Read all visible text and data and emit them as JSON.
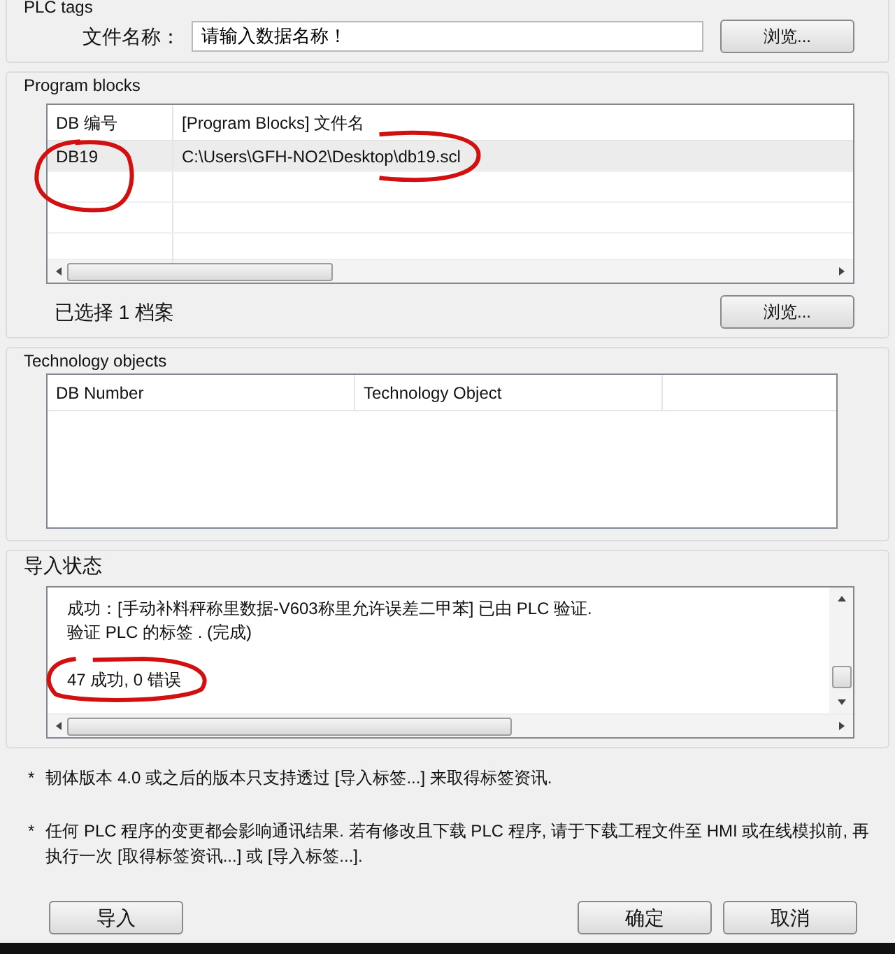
{
  "plc_tags": {
    "title": "PLC tags",
    "file_label": "文件名称：",
    "file_field": {
      "value": "请输入数据名称！"
    },
    "browse_button": "浏览..."
  },
  "program_blocks": {
    "title": "Program blocks",
    "table": {
      "columns": [
        "DB 编号",
        "[Program Blocks] 文件名"
      ],
      "rows": [
        {
          "cells": [
            "DB19",
            "C:\\Users\\GFH-NO2\\Desktop\\db19.scl"
          ],
          "selected": true
        }
      ]
    },
    "selection_count": "已选择 1 档案",
    "browse_button": "浏览..."
  },
  "technology_objects": {
    "title": "Technology objects",
    "table": {
      "columns": [
        "DB Number",
        "Technology Object"
      ]
    }
  },
  "import_status": {
    "title": "导入状态",
    "lines": [
      {
        "text": "成功：[手动补料秤称里数据-V603称里允许误差二甲苯] 已由 PLC 验证.",
        "kind": "message"
      },
      {
        "text": "验证 PLC 的标签 . (完成)",
        "kind": "message"
      },
      {
        "text": "47 成功, 0 错误",
        "kind": "summary"
      }
    ]
  },
  "notes": [
    "韧体版本 4.0 或之后的版本只支持透过 [导入标签...] 来取得标签资讯.",
    "任何 PLC 程序的变更都会影响通讯结果. 若有修改且下载 PLC 程序, 请于下载工程文件至 HMI 或在线模拟前, 再执行一次 [取得标签资讯...] 或 [导入标签...]."
  ],
  "note_marker": "*",
  "buttons": [
    {
      "label": "导入",
      "kind": "left"
    },
    {
      "label": "确定",
      "kind": "right"
    },
    {
      "label": "取消",
      "kind": "right"
    }
  ]
}
